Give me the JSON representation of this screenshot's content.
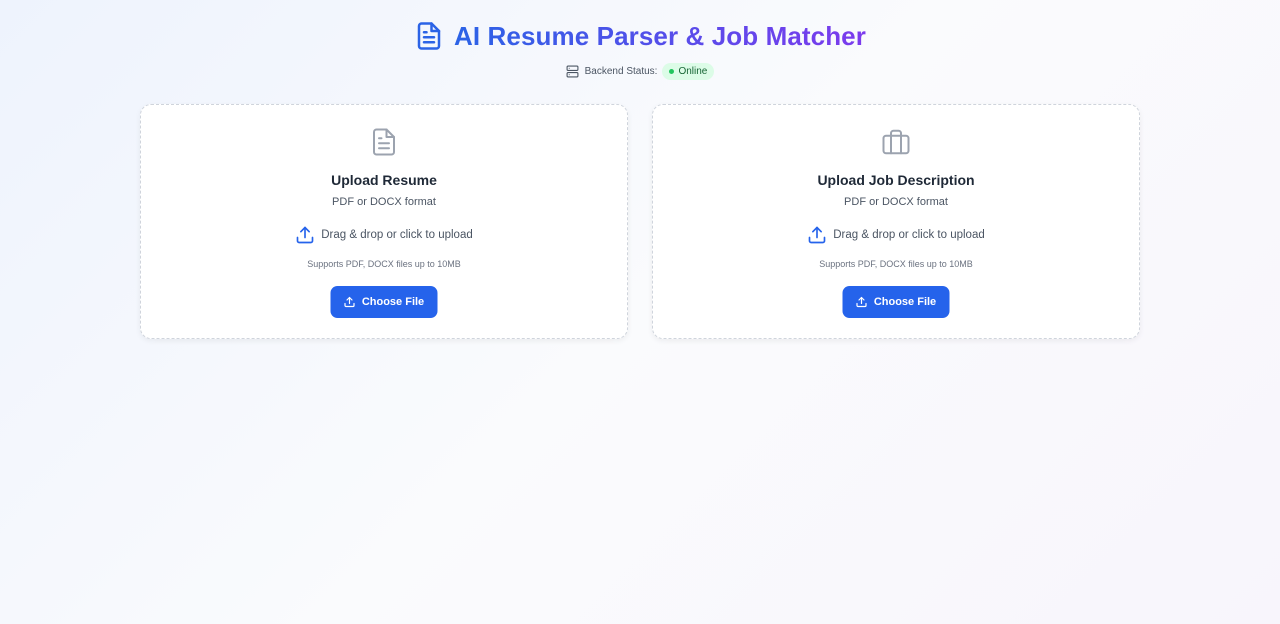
{
  "header": {
    "title": "AI Resume Parser & Job Matcher",
    "title_icon": "document-icon",
    "gradient_start": "#2b63e6",
    "gradient_end": "#7c3aed"
  },
  "status": {
    "label": "Backend Status:",
    "value": "Online",
    "icon": "server-icon",
    "color": "#22c55e"
  },
  "cards": [
    {
      "icon": "document-icon",
      "title": "Upload Resume",
      "subtitle": "PDF or DOCX format",
      "drop_text": "Drag & drop or click to upload",
      "support_text": "Supports PDF, DOCX files up to 10MB",
      "button_label": "Choose File"
    },
    {
      "icon": "briefcase-icon",
      "title": "Upload Job Description",
      "subtitle": "PDF or DOCX format",
      "drop_text": "Drag & drop or click to upload",
      "support_text": "Supports PDF, DOCX files up to 10MB",
      "button_label": "Choose File"
    }
  ],
  "colors": {
    "accent": "#2563eb",
    "online_badge_bg": "#dcfce7",
    "online_badge_text": "#166534"
  }
}
